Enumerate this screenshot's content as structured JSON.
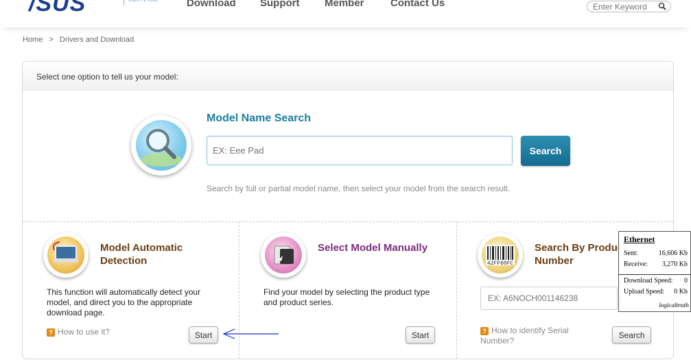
{
  "header": {
    "logo": "/SUS",
    "service": "SERVICE",
    "nav": [
      "Download",
      "Support",
      "Member",
      "Contact Us"
    ],
    "search_placeholder": "Enter Keyword"
  },
  "breadcrumb": {
    "home": "Home",
    "sep": ">",
    "current": "Drivers and Download"
  },
  "panel": {
    "heading": "Select one option to tell us your model:",
    "model_name_search": {
      "title": "Model Name Search",
      "placeholder": "EX: Eee Pad",
      "button": "Search",
      "hint": "Search by full or partial model name, then select your model from the search result."
    },
    "columns": [
      {
        "title_line1": "Model Automatic",
        "title_line2": "Detection",
        "title_color": "#6b3e12",
        "desc_line1": "This function will automatically detect your",
        "desc_line2": "model, and direct you to the appropriate",
        "desc_line3": "download page.",
        "help": "How to use it?",
        "button": "Start"
      },
      {
        "title_line1": "Select Model Manually",
        "title_color": "#7b2a7e",
        "desc_line1": "Find your model by selecting the product type",
        "desc_line2": "and product series.",
        "button": "Start"
      },
      {
        "title_line1": "Search By Produc",
        "title_line2": "Number",
        "title_color": "#6b3e12",
        "barcode_text": "42FF60FC",
        "placeholder": "EX: A6NOCH001146238",
        "help_line1": "How to identify Serial",
        "help_line2": "Number?",
        "button": "Search"
      }
    ]
  },
  "net_widget": {
    "title": "Ethernet",
    "sent_label": "Sent:",
    "sent_value": "16,606 Kb",
    "receive_label": "Receive:",
    "receive_value": "3,270 Kb",
    "download_label": "Download Speed:",
    "download_value": "0",
    "upload_label": "Upload Speed:",
    "upload_value": "0 Kb",
    "brand": "logicaltruth"
  },
  "colors": {
    "brand": "#1d3f8f",
    "accent": "#1c7ea0",
    "arrow": "#1a2fd6"
  }
}
